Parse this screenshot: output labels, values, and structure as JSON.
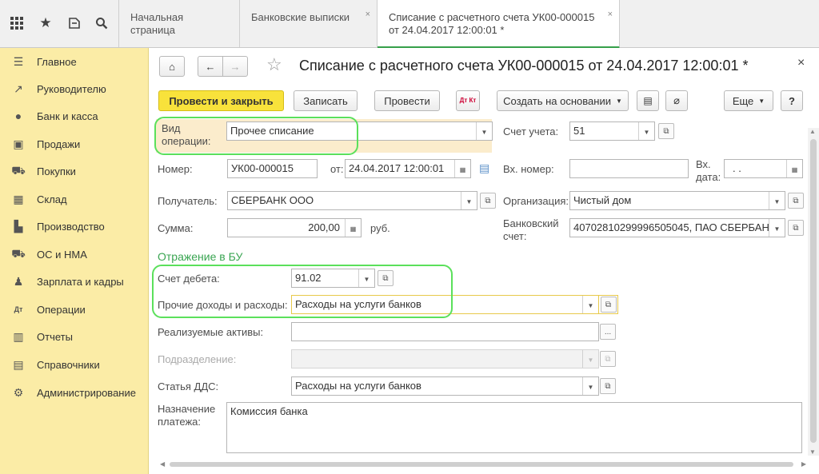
{
  "topbar": {
    "icons": [
      "apps-grid-icon",
      "star-icon",
      "history-icon",
      "search-icon"
    ],
    "tabs": [
      {
        "label": "Начальная страница"
      },
      {
        "label": "Банковские выписки",
        "close": "×"
      },
      {
        "label_line1": "Списание с расчетного счета УК00-000015",
        "label_line2": "от 24.04.2017 12:00:01 *",
        "close": "×"
      }
    ]
  },
  "sidebar": {
    "items": [
      {
        "label": "Главное",
        "icon": "menu-icon",
        "glyph": "☰"
      },
      {
        "label": "Руководителю",
        "icon": "chart-trend-icon",
        "glyph": "↗"
      },
      {
        "label": "Банк и касса",
        "icon": "coin-icon",
        "glyph": "●"
      },
      {
        "label": "Продажи",
        "icon": "bag-icon",
        "glyph": "▣"
      },
      {
        "label": "Покупки",
        "icon": "cart-icon",
        "glyph": "⛟"
      },
      {
        "label": "Склад",
        "icon": "warehouse-icon",
        "glyph": "▦"
      },
      {
        "label": "Производство",
        "icon": "factory-icon",
        "glyph": "▙"
      },
      {
        "label": "ОС и НМА",
        "icon": "truck-icon",
        "glyph": "⛟"
      },
      {
        "label": "Зарплата и кадры",
        "icon": "person-icon",
        "glyph": "♟"
      },
      {
        "label": "Операции",
        "icon": "debit-credit-icon",
        "glyph": "Дт"
      },
      {
        "label": "Отчеты",
        "icon": "bar-chart-icon",
        "glyph": "▥"
      },
      {
        "label": "Справочники",
        "icon": "books-icon",
        "glyph": "▤"
      },
      {
        "label": "Администрирование",
        "icon": "gear-icon",
        "glyph": "⚙"
      }
    ]
  },
  "form": {
    "title": "Списание с расчетного счета УК00-000015 от 24.04.2017 12:00:01 *",
    "close": "×",
    "toolbar": {
      "post_and_close": "Провести и закрыть",
      "save": "Записать",
      "post": "Провести",
      "dtkt": "Дт Кт",
      "create_based_on": "Создать на основании",
      "more": "Еще",
      "help": "?"
    },
    "fields": {
      "operation_type_label_1": "Вид",
      "operation_type_label_2": "операции:",
      "operation_type_value": "Прочее списание",
      "account_label": "Счет учета:",
      "account_value": "51",
      "number_label": "Номер:",
      "number_value": "УК00-000015",
      "from_label": "от:",
      "date_value": "24.04.2017 12:00:01",
      "in_number_label": "Вх. номер:",
      "in_number_value": "",
      "in_date_label_1": "Вх.",
      "in_date_label_2": "дата:",
      "in_date_value": ".   .",
      "recipient_label": "Получатель:",
      "recipient_value": "СБЕРБАНК ООО",
      "org_label": "Организация:",
      "org_value": "Чистый дом",
      "sum_label": "Сумма:",
      "sum_value": "200,00",
      "currency": "руб.",
      "bank_account_label_1": "Банковский",
      "bank_account_label_2": "счет:",
      "bank_account_value": "40702810299996505045, ПАО СБЕРБАНК"
    },
    "section_bu": {
      "title": "Отражение в БУ",
      "debit_label": "Счет дебета:",
      "debit_value": "91.02",
      "other_label": "Прочие доходы и расходы:",
      "other_value": "Расходы на услуги банков",
      "assets_label": "Реализуемые активы:",
      "assets_value": "",
      "dept_label": "Подразделение:",
      "dept_value": "",
      "dds_label": "Статья ДДС:",
      "dds_value": "Расходы на услуги банков",
      "purpose_label_1": "Назначение",
      "purpose_label_2": "платежа:",
      "purpose_value": "Комиссия банка"
    }
  }
}
